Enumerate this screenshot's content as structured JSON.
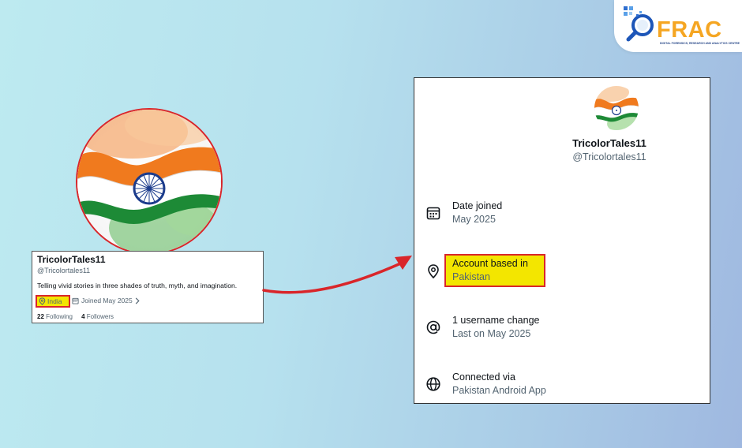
{
  "logo": {
    "text": "FRAC",
    "tagline": "DIGITAL FORENSICS, RESEARCH AND ANALYTICS CENTRE"
  },
  "profile_card": {
    "name": "TricolorTales11",
    "handle": "@Tricolortales11",
    "bio": "Telling vivid stories in three shades of truth, myth, and imagination.",
    "location": "India",
    "joined": "Joined May 2025",
    "following_count": "22",
    "following_label": "Following",
    "followers_count": "4",
    "followers_label": "Followers"
  },
  "about_panel": {
    "name": "TricolorTales11",
    "handle": "@Tricolortales11",
    "rows": [
      {
        "label": "Date joined",
        "value": "May 2025",
        "icon": "calendar-icon"
      },
      {
        "label": "Account based in",
        "value": "Pakistan",
        "icon": "location-pin-icon"
      },
      {
        "label": "1 username change",
        "value": "Last on May 2025",
        "icon": "at-sign-icon"
      },
      {
        "label": "Connected via",
        "value": "Pakistan Android App",
        "icon": "globe-icon"
      }
    ]
  },
  "colors": {
    "highlight": "#f3e600",
    "highlight_border": "#d9262a",
    "arrow": "#d9262a",
    "logo_accent": "#f5a623"
  }
}
